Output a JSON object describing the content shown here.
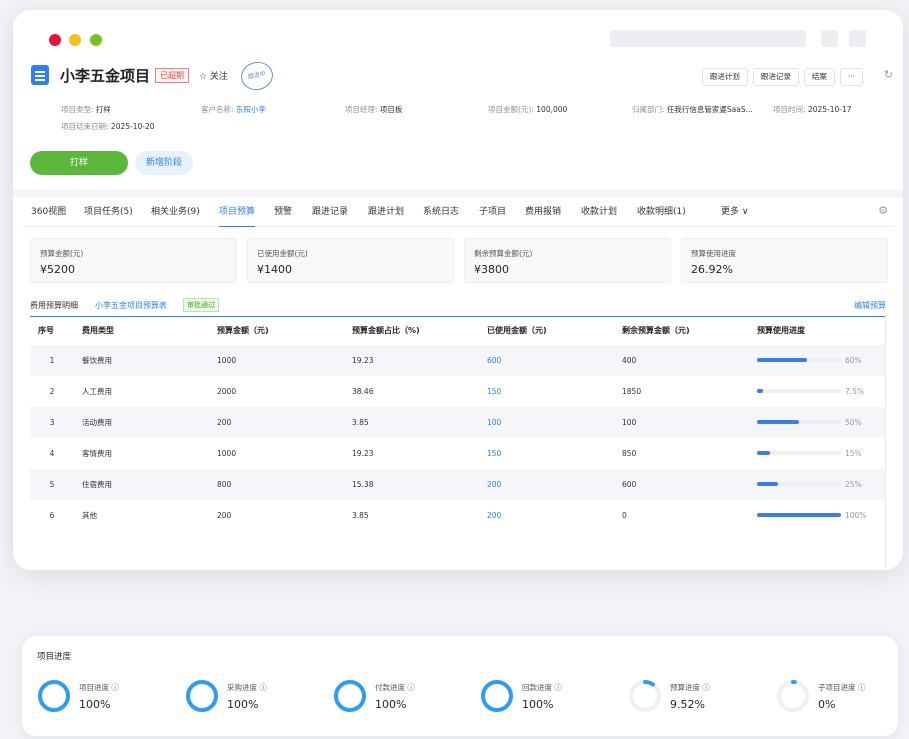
{
  "header": {
    "title": "小李五金项目",
    "overdue": "已超期",
    "follow": "☆ 关注",
    "stamp": "跟进中",
    "buttons": [
      "跟进计划",
      "跟进记录",
      "结案",
      "···"
    ],
    "meta": {
      "type_label": "项目类型:",
      "type": "打样",
      "customer_label": "客户名称:",
      "customer": "东阳小李",
      "manager_label": "项目经理:",
      "manager": "项目板",
      "amount_label": "项目金额(元):",
      "amount": "100,000",
      "dept_label": "归属部门:",
      "dept": "任我行信息管家婆SaaS...",
      "time_label": "项目时间:",
      "time": "2025-10-17",
      "end_label": "项目结束日期:",
      "end": "2025-10-20"
    }
  },
  "stage": {
    "current": "打样",
    "add": "新增阶段"
  },
  "tabs": [
    "360视图",
    "项目任务(5)",
    "相关业务(9)",
    "项目预算",
    "预警",
    "跟进记录",
    "跟进计划",
    "系统日志",
    "子项目",
    "费用报销",
    "收款计划",
    "收款明细(1)",
    "更多  ∨"
  ],
  "active_tab": 3,
  "cards": [
    {
      "label": "预算金额(元)",
      "value": "¥5200"
    },
    {
      "label": "已使用金额(元)",
      "value": "¥1400"
    },
    {
      "label": "剩余预算金额(元)",
      "value": "¥3800"
    },
    {
      "label": "预算使用进度",
      "value": "26.92%"
    }
  ],
  "detail": {
    "title": "费用预算明细",
    "link": "小李五金项目预算表",
    "status": "审批通过",
    "edit": "编辑预算"
  },
  "table": {
    "headers": [
      "序号",
      "费用类型",
      "预算金额（元)",
      "预算金额占比（%)",
      "已使用金额（元)",
      "剩余预算金额（元)",
      "预算使用进度"
    ],
    "rows": [
      {
        "no": "1",
        "type": "餐饮费用",
        "budget": "1000",
        "ratio": "19.23",
        "used": "600",
        "remain": "400",
        "pct": "60%",
        "frac": 0.6
      },
      {
        "no": "2",
        "type": "人工费用",
        "budget": "2000",
        "ratio": "38.46",
        "used": "150",
        "remain": "1850",
        "pct": "7.5%",
        "frac": 0.075
      },
      {
        "no": "3",
        "type": "活动费用",
        "budget": "200",
        "ratio": "3.85",
        "used": "100",
        "remain": "100",
        "pct": "50%",
        "frac": 0.5
      },
      {
        "no": "4",
        "type": "客情费用",
        "budget": "1000",
        "ratio": "19.23",
        "used": "150",
        "remain": "850",
        "pct": "15%",
        "frac": 0.15
      },
      {
        "no": "5",
        "type": "住宿费用",
        "budget": "800",
        "ratio": "15.38",
        "used": "200",
        "remain": "600",
        "pct": "25%",
        "frac": 0.25
      },
      {
        "no": "6",
        "type": "其他",
        "budget": "200",
        "ratio": "3.85",
        "used": "200",
        "remain": "0",
        "pct": "100%",
        "frac": 1.0
      }
    ]
  },
  "progress": {
    "title": "项目进度",
    "items": [
      {
        "label": "项目进度 ⓘ",
        "value": "100%",
        "frac": 1.0
      },
      {
        "label": "采购进度 ⓘ",
        "value": "100%",
        "frac": 1.0
      },
      {
        "label": "付款进度 ⓘ",
        "value": "100%",
        "frac": 1.0
      },
      {
        "label": "回款进度 ⓘ",
        "value": "100%",
        "frac": 1.0
      },
      {
        "label": "预算进度 ⓘ",
        "value": "9.52%",
        "frac": 0.0952
      },
      {
        "label": "子项目进度 ⓘ",
        "value": "0%",
        "frac": 0.0
      }
    ]
  },
  "colors": {
    "accent": "#2f7ff5",
    "green": "#5cb83a",
    "ring": "#2f9cf0"
  }
}
